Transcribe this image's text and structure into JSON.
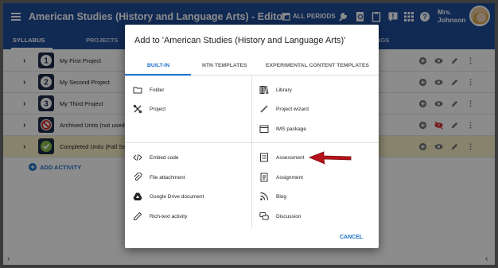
{
  "app": {
    "title": "American Studies (History and Language Arts) - Editor",
    "periods_label": "ALL PERIODS",
    "user_name_line1": "Mrs.",
    "user_name_line2": "Johnson"
  },
  "tabs": [
    {
      "label": "SYLLABUS",
      "active": true
    },
    {
      "label": "PROJECTS",
      "active": false
    },
    {
      "label": "NGS",
      "active": false
    }
  ],
  "rows": [
    {
      "number": "1",
      "title": "My First Project",
      "highlighted": false
    },
    {
      "number": "2",
      "title": "My Second Project",
      "highlighted": false
    },
    {
      "number": "3",
      "title": "My Third Project",
      "highlighted": false
    },
    {
      "number": "",
      "title": "Archived Units (not used",
      "highlighted": false
    },
    {
      "number": "",
      "title": "Completed Units (Fall Se",
      "highlighted": true
    }
  ],
  "add_activity_label": "ADD ACTIVITY",
  "dialog": {
    "title": "Add to 'American Studies (History and Language Arts)'",
    "tabs": [
      "BUILT-IN",
      "NTN TEMPLATES",
      "EXPERIMENTAL CONTENT TEMPLATES"
    ],
    "left_top": [
      {
        "label": "Folder",
        "icon": "folder-icon"
      },
      {
        "label": "Project",
        "icon": "project-icon"
      }
    ],
    "right_top": [
      {
        "label": "Library",
        "icon": "library-icon"
      },
      {
        "label": "Project wizard",
        "icon": "wand-icon"
      },
      {
        "label": "IMS package",
        "icon": "package-icon"
      }
    ],
    "left_bottom": [
      {
        "label": "Embed code",
        "icon": "code-icon"
      },
      {
        "label": "File attachment",
        "icon": "paperclip-icon"
      },
      {
        "label": "Google Drive document",
        "icon": "google-drive-icon"
      },
      {
        "label": "Rich-text activity",
        "icon": "pencil-icon"
      }
    ],
    "right_bottom": [
      {
        "label": "Assessment",
        "icon": "assessment-icon"
      },
      {
        "label": "Assignment",
        "icon": "assignment-icon"
      },
      {
        "label": "Blog",
        "icon": "blog-icon"
      },
      {
        "label": "Discussion",
        "icon": "discussion-icon"
      }
    ],
    "cancel_label": "CANCEL"
  },
  "colors": {
    "appbar": "#1f4e99",
    "accent": "#1f73c9",
    "highlight_row": "#f6efc6",
    "arrow": "#b5121b"
  }
}
